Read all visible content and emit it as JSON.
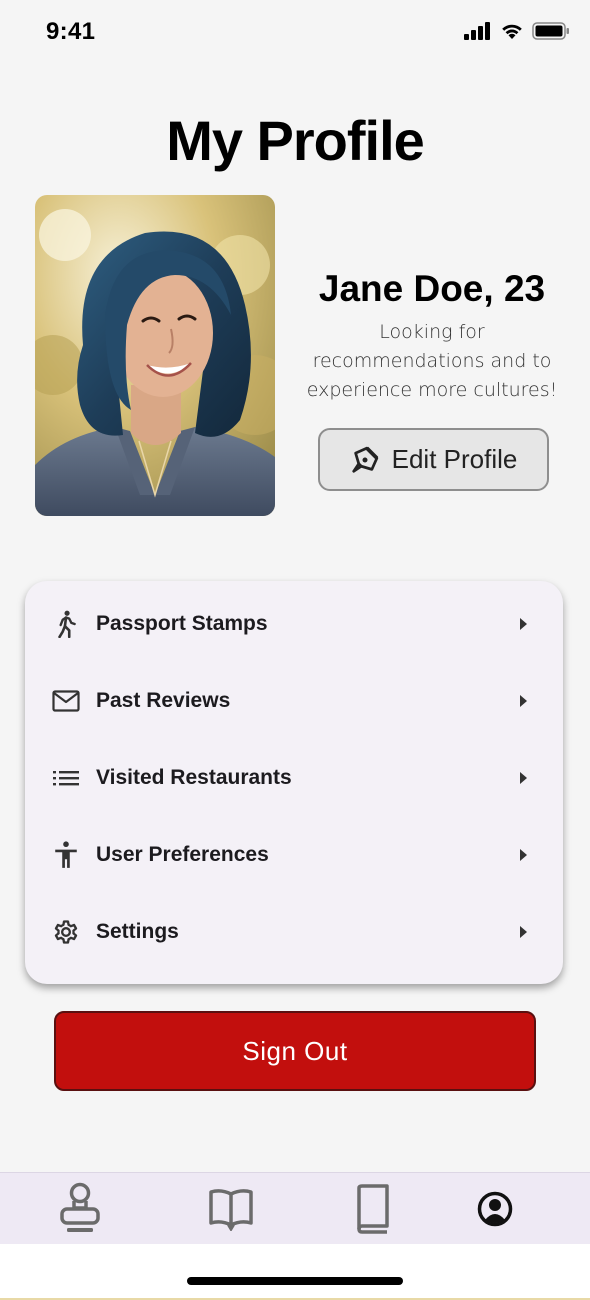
{
  "status_bar": {
    "time": "9:41"
  },
  "page": {
    "title": "My Profile"
  },
  "profile": {
    "name": "Jane Doe, 23",
    "bio": "Looking for recommendations and to experience more cultures!",
    "edit_label": "Edit Profile",
    "edit_icon": "pen-tool-icon"
  },
  "menu": {
    "items": [
      {
        "label": "Passport Stamps",
        "icon": "walking-person-icon"
      },
      {
        "label": "Past Reviews",
        "icon": "mail-icon"
      },
      {
        "label": "Visited Restaurants",
        "icon": "list-icon"
      },
      {
        "label": "User Preferences",
        "icon": "accessibility-person-icon"
      },
      {
        "label": "Settings",
        "icon": "gear-icon"
      }
    ]
  },
  "sign_out": {
    "label": "Sign Out",
    "color": "#c20f0d"
  },
  "bottom_nav": {
    "items": [
      {
        "icon": "passport-stamp-icon",
        "active": false
      },
      {
        "icon": "open-book-icon",
        "active": false
      },
      {
        "icon": "closed-book-icon",
        "active": false
      },
      {
        "icon": "account-circle-icon",
        "active": true
      }
    ]
  },
  "colors": {
    "background": "#f5f5f5",
    "menu_card": "#f4f1f7",
    "bottom_nav": "#eee9f4",
    "accent_red": "#c20f0d"
  }
}
